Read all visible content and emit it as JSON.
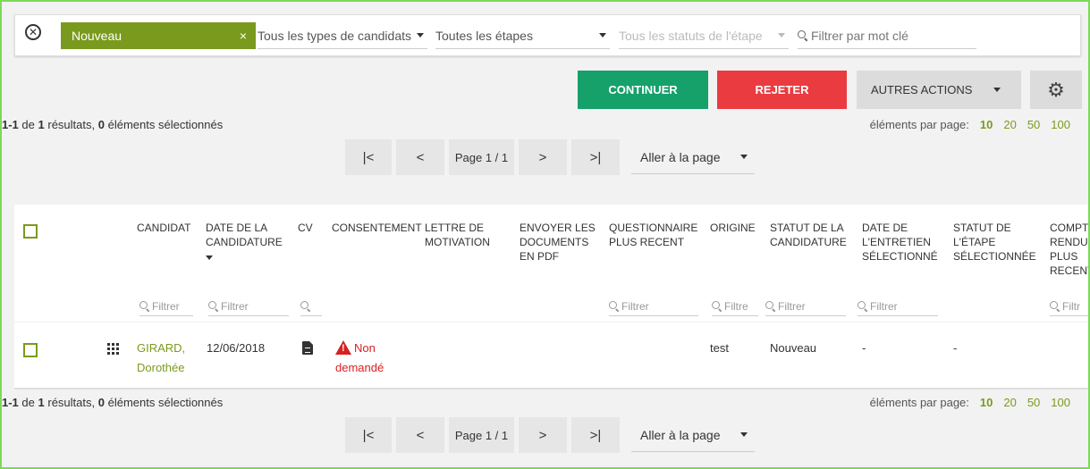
{
  "filters": {
    "chip_label": "Nouveau",
    "chip_close": "×",
    "candidate_types": "Tous les types de candidats",
    "steps": "Toutes les étapes",
    "step_statuses": "Tous les statuts de l'étape",
    "keyword_placeholder": "Filtrer par mot clé"
  },
  "actions": {
    "continue": "CONTINUER",
    "reject": "REJETER",
    "other": "AUTRES ACTIONS",
    "continue_color": "#16a06a",
    "reject_color": "#ea3b40"
  },
  "results": {
    "range": "1-1",
    "of": "de",
    "total": "1",
    "results_word": "résultats,",
    "selected": "0",
    "selected_word": "éléments sélectionnés",
    "per_page_label": "éléments par page:",
    "per_page_options": [
      "10",
      "20",
      "50",
      "100"
    ],
    "per_page_selected": "10"
  },
  "pagination": {
    "first": "|<",
    "prev": "<",
    "page_label": "Page 1 / 1",
    "next": ">",
    "last": ">|",
    "goto": "Aller à la page"
  },
  "table": {
    "columns": {
      "candidat": "CANDIDAT",
      "date_candidature": "DATE DE LA CANDIDATURE",
      "cv": "CV",
      "consentement": "CONSENTEMENT",
      "lettre": "LETTRE DE MOTIVATION",
      "envoyer": "ENVOYER LES DOCUMENTS EN PDF",
      "questionnaire": "QUESTIONNAIRE PLUS RECENT",
      "origine": "ORIGINE",
      "statut_candidature": "STATUT DE LA CANDIDATURE",
      "date_entretien": "DATE DE L'ENTRETIEN SÉLECTIONNÉ",
      "statut_etape": "STATUT DE L'ÉTAPE SÉLECTIONNÉE",
      "compte_rendu": "COMPTE RENDU PLUS RECENT"
    },
    "filter_placeholder": "Filtrer",
    "filter_truncated": "Filtre",
    "filter_truncated2": "Filtr",
    "rows": [
      {
        "candidat_line1": "GIRARD,",
        "candidat_line2": "Dorothée",
        "date": "12/06/2018",
        "consentement_line1": "Non",
        "consentement_line2": "demandé",
        "origine": "test",
        "statut": "Nouveau",
        "date_entretien": "-",
        "statut_etape": "-"
      }
    ]
  },
  "colors": {
    "accent": "#7a9a1e",
    "frame_border": "#7ed957",
    "warning": "#d92020"
  }
}
